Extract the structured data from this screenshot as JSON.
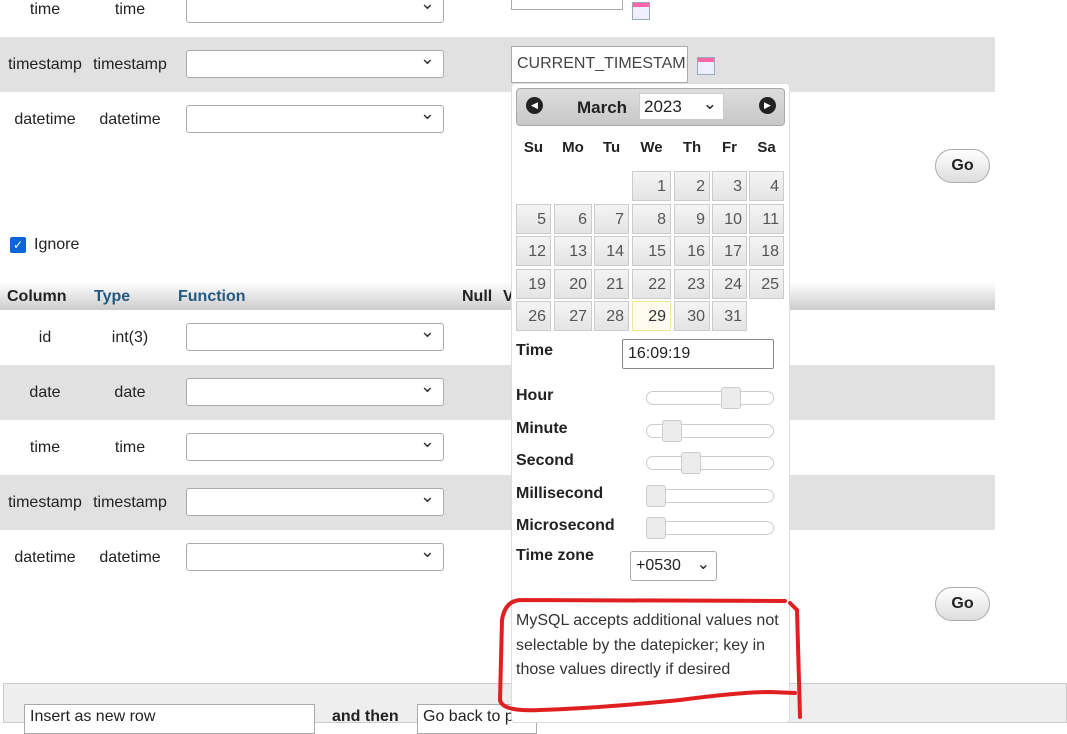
{
  "top_rows": [
    {
      "column": "time",
      "type": "time"
    },
    {
      "column": "timestamp",
      "type": "timestamp",
      "value": "CURRENT_TIMESTAMP"
    },
    {
      "column": "datetime",
      "type": "datetime"
    }
  ],
  "go_label": "Go",
  "ignore_label": "Ignore",
  "ignore_checked": true,
  "headers": {
    "column": "Column",
    "type": "Type",
    "function": "Function",
    "null": "Null",
    "value": "V"
  },
  "rows": [
    {
      "column": "id",
      "type": "int(3)"
    },
    {
      "column": "date",
      "type": "date"
    },
    {
      "column": "time",
      "type": "time"
    },
    {
      "column": "timestamp",
      "type": "timestamp"
    },
    {
      "column": "datetime",
      "type": "datetime"
    }
  ],
  "datepicker": {
    "month": "March",
    "year": "2023",
    "prev_icon": "circle-left",
    "next_icon": "circle-right",
    "weekdays": [
      "Su",
      "Mo",
      "Tu",
      "We",
      "Th",
      "Fr",
      "Sa"
    ],
    "first_weekday_index": 3,
    "days_in_month": 31,
    "today": 29,
    "time_label": "Time",
    "time_value": "16:09:19",
    "sliders": [
      {
        "label": "Hour",
        "value": 16,
        "max": 23
      },
      {
        "label": "Minute",
        "value": 9,
        "max": 59
      },
      {
        "label": "Second",
        "value": 19,
        "max": 59
      },
      {
        "label": "Millisecond",
        "value": 0,
        "max": 999
      },
      {
        "label": "Microsecond",
        "value": 0,
        "max": 999
      }
    ],
    "timezone_label": "Time zone",
    "timezone_value": "+0530",
    "note": "MySQL accepts additional values not selectable by the datepicker; key in those values directly if desired"
  },
  "annotation_color": "#e02020",
  "footer": {
    "insert_select": "Insert as new row",
    "and_then": "and then",
    "after_select": "Go back to p"
  }
}
